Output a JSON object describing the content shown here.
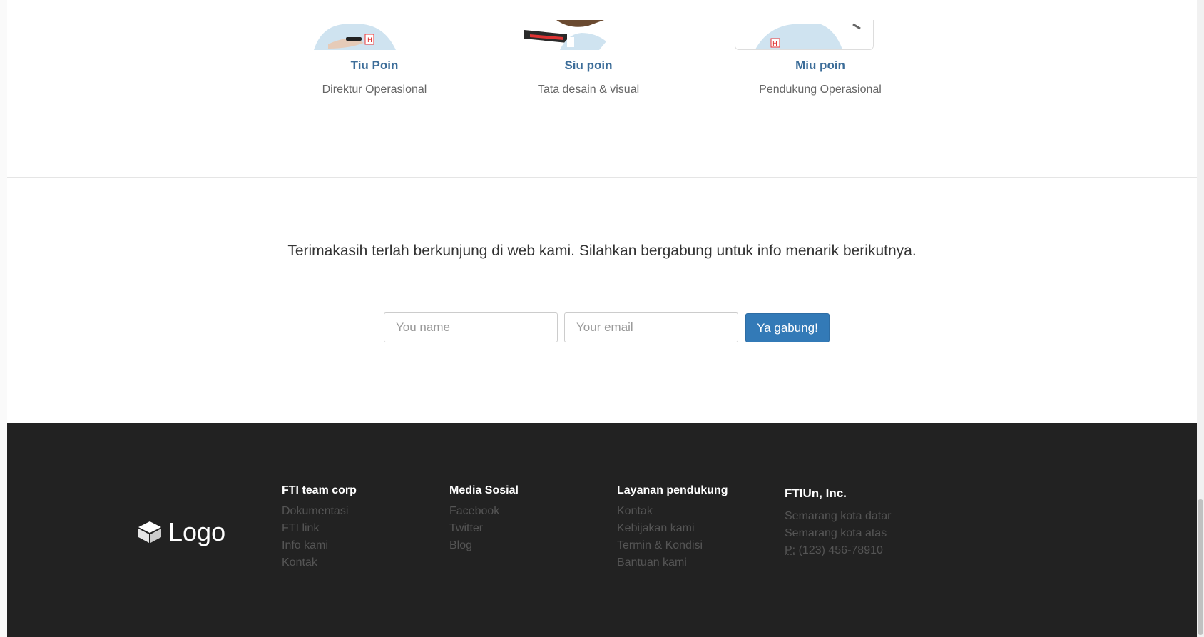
{
  "team": {
    "members": [
      {
        "name": "Tiu Poin",
        "role": "Direktur Operasional"
      },
      {
        "name": "Siu poin",
        "role": "Tata desain & visual"
      },
      {
        "name": "Miu poin",
        "role": "Pendukung Operasional"
      }
    ]
  },
  "newsletter": {
    "message": "Terimakasih terlah berkunjung di web kami. Silahkan bergabung untuk info menarik berikutnya.",
    "name_placeholder": "You name",
    "email_placeholder": "Your email",
    "submit_label": "Ya gabung!"
  },
  "footer": {
    "logo_text": "Logo",
    "columns": [
      {
        "title": "FTI team corp",
        "links": [
          "Dokumentasi",
          "FTI link",
          "Info kami",
          "Kontak"
        ]
      },
      {
        "title": "Media Sosial",
        "links": [
          "Facebook",
          "Twitter",
          "Blog"
        ]
      },
      {
        "title": "Layanan pendukung",
        "links": [
          "Kontak",
          "Kebijakan kami",
          "Termin & Kondisi",
          "Bantuan kami"
        ]
      }
    ],
    "address": {
      "title": "FTIUn, Inc.",
      "line1": "Semarang kota datar",
      "line2": "Semarang kota atas",
      "phone_label": "P:",
      "phone": " (123) 456-78910"
    }
  },
  "colors": {
    "accent": "#337ab7",
    "name_color": "#3c6d99",
    "footer_bg": "#222222"
  }
}
